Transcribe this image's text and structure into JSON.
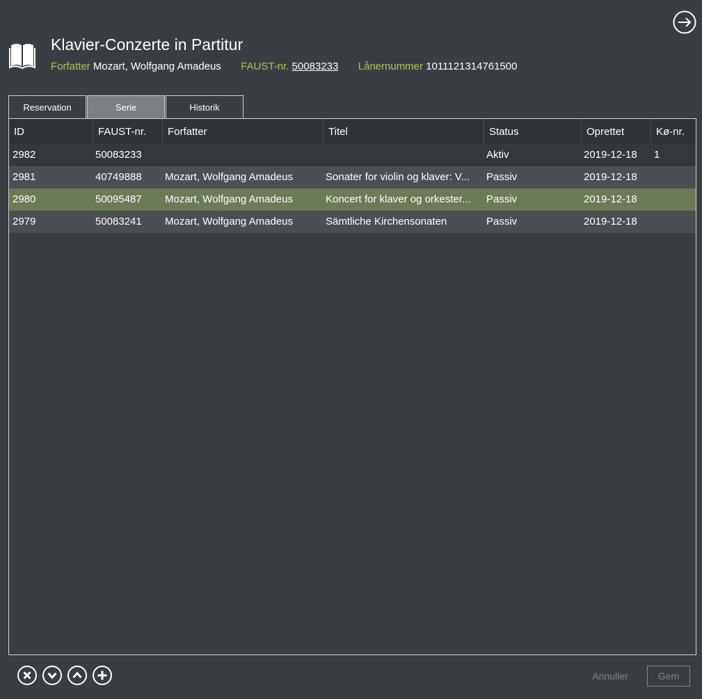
{
  "header": {
    "title": "Klavier-Conzerte in Partitur",
    "author_label": "Forfatter",
    "author_value": "Mozart, Wolfgang Amadeus",
    "faust_label": "FAUST-nr.",
    "faust_value": "50083233",
    "loan_label": "Lånernummer",
    "loan_value": "1011121314761500",
    "icons": {
      "book": "book-icon",
      "navigate": "arrow-right-circle-icon"
    }
  },
  "tabs": [
    {
      "label": "Reservation",
      "active": false
    },
    {
      "label": "Serie",
      "active": true
    },
    {
      "label": "Historik",
      "active": false
    }
  ],
  "table": {
    "columns": [
      "ID",
      "FAUST-nr.",
      "Forfatter",
      "Titel",
      "Status",
      "Oprettet",
      "Kø-nr."
    ],
    "rows": [
      [
        "2982",
        "50083233",
        "",
        "",
        "Aktiv",
        "2019-12-18",
        "1"
      ],
      [
        "2981",
        "40749888",
        "Mozart, Wolfgang Amadeus",
        "Sonater for violin og klaver: V...",
        "Passiv",
        "2019-12-18",
        ""
      ],
      [
        "2980",
        "50095487",
        "Mozart, Wolfgang Amadeus",
        "Koncert for klaver og orkester...",
        "Passiv",
        "2019-12-18",
        ""
      ],
      [
        "2979",
        "50083241",
        "Mozart, Wolfgang Amadeus",
        "Sämtliche Kirchensonaten",
        "Passiv",
        "2019-12-18",
        ""
      ]
    ],
    "selected_row": "2980"
  },
  "footer": {
    "action_icons": [
      "remove-icon",
      "move-down-icon",
      "move-up-icon",
      "add-icon"
    ],
    "cancel_label": "Annuller",
    "save_label": "Gem"
  },
  "colors": {
    "background": "#3a3e42",
    "label_green": "#a8c25f",
    "selected_row": "#6d7a56",
    "active_tab": "#7b8084",
    "disabled_text": "#7d8286"
  }
}
